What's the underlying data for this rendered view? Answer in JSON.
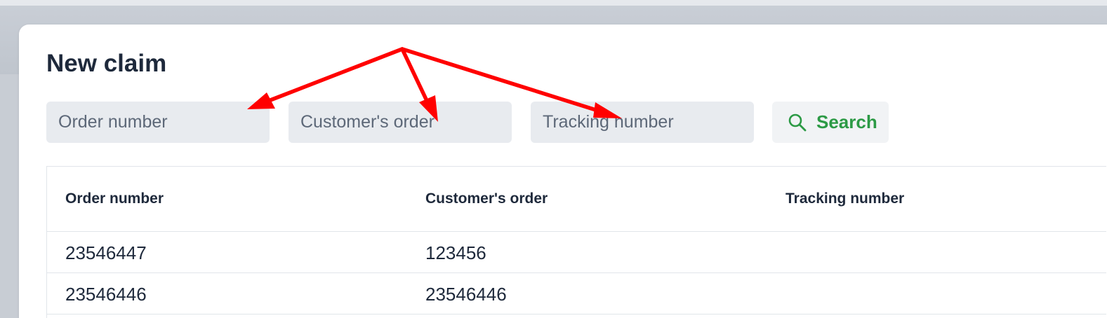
{
  "page": {
    "title": "New claim"
  },
  "search": {
    "order_number_placeholder": "Order number",
    "customer_order_placeholder": "Customer's order",
    "tracking_number_placeholder": "Tracking number",
    "button_label": "Search",
    "button_icon": "search-icon"
  },
  "table": {
    "headers": [
      "Order number",
      "Customer's order",
      "Tracking number"
    ],
    "rows": [
      [
        "23546447",
        "123456",
        ""
      ],
      [
        "23546446",
        "23546446",
        ""
      ]
    ]
  },
  "colors": {
    "accent": "#2c9a45",
    "annotation": "#ff0000",
    "text": "#1e293b",
    "field_background": "#e8ebef"
  }
}
